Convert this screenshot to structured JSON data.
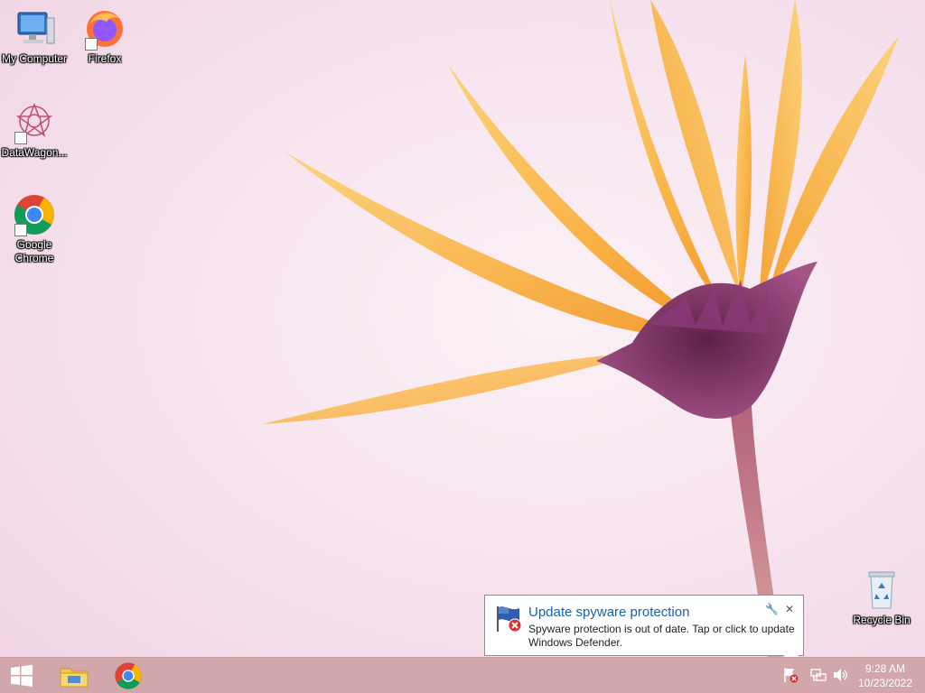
{
  "desktop": {
    "icons": [
      {
        "label": "My Computer"
      },
      {
        "label": "Firefox"
      },
      {
        "label": "DataWagon..."
      },
      {
        "label": "Google Chrome"
      },
      {
        "label": "Recycle Bin"
      }
    ]
  },
  "notification": {
    "title": "Update spyware protection",
    "body": "Spyware protection is out of date. Tap or click to update Windows Defender.",
    "options_icon": "wrench-icon",
    "close_icon": "close-icon"
  },
  "taskbar": {
    "start_icon": "windows-logo-icon",
    "pinned": [
      {
        "icon": "file-explorer-icon"
      },
      {
        "icon": "chrome-icon"
      }
    ],
    "tray": [
      {
        "icon": "action-center-flag-error-icon"
      },
      {
        "icon": "network-icon"
      },
      {
        "icon": "speaker-icon"
      }
    ],
    "clock": {
      "time": "9:28 AM",
      "date": "10/23/2022"
    }
  },
  "colors": {
    "taskbar": "#d1a7ac",
    "accent_title": "#1a5fb4"
  }
}
